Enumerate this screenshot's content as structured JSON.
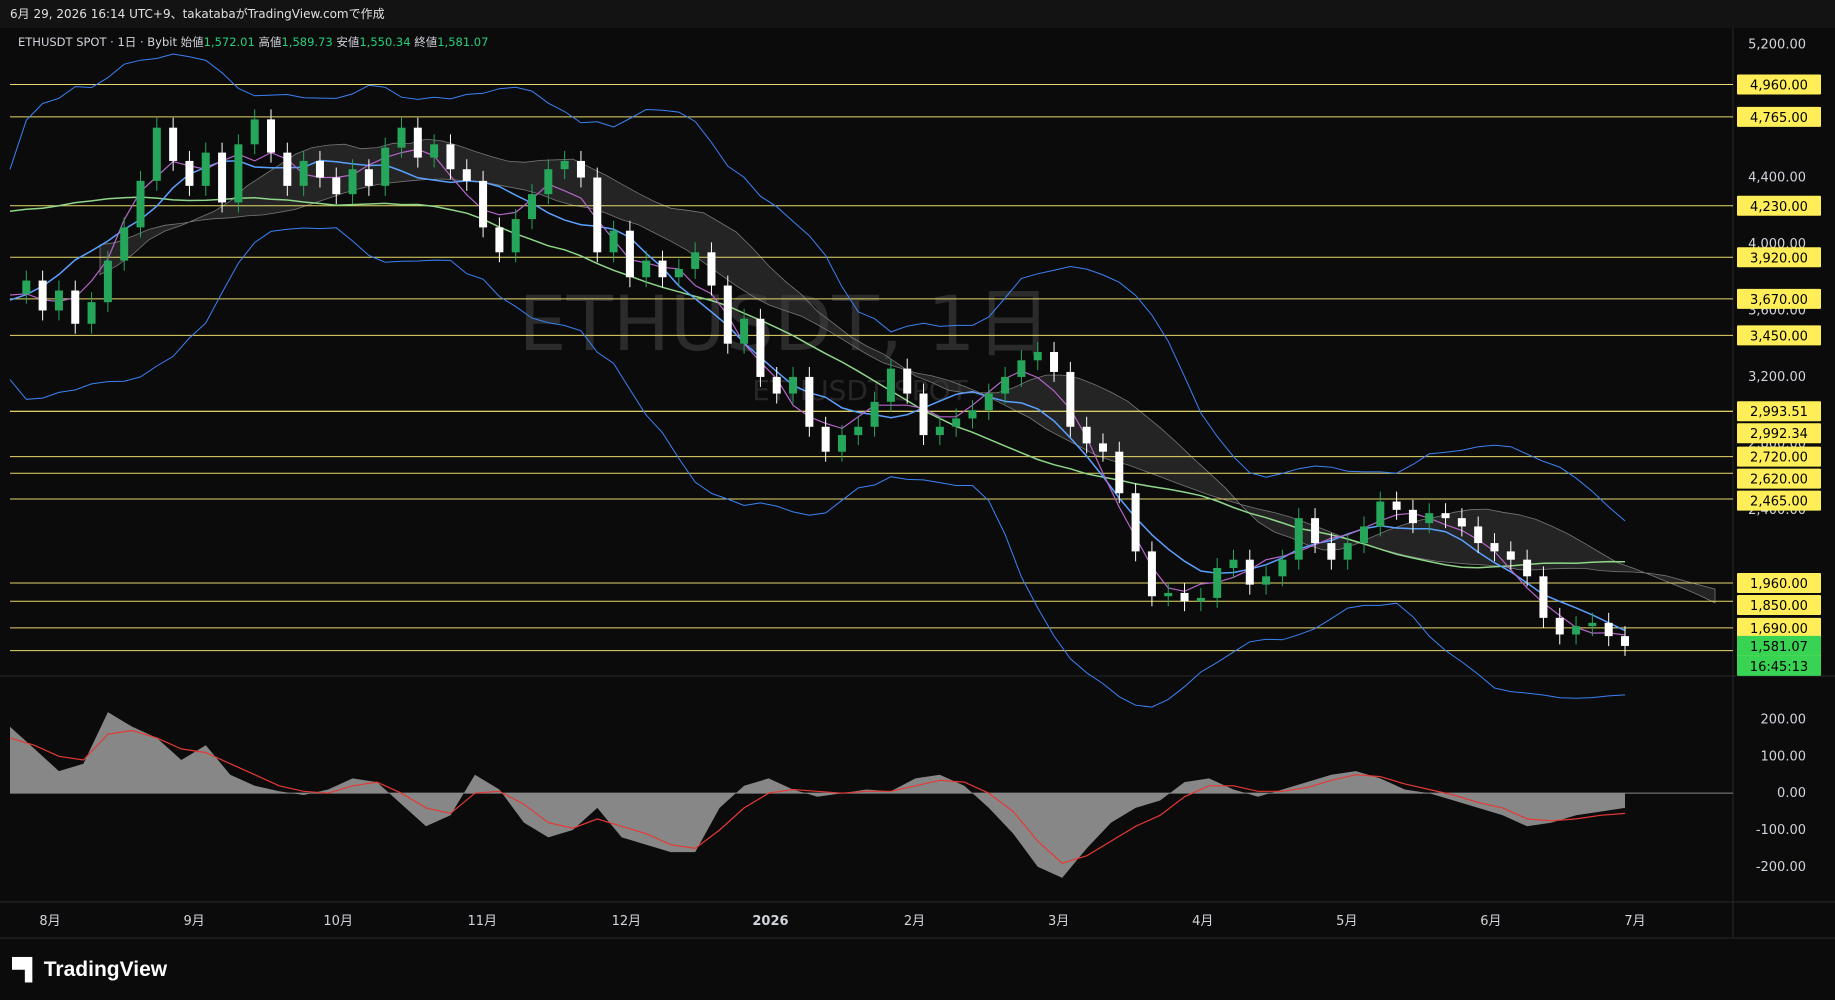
{
  "header": {
    "caption": "6月 29, 2026 16:14 UTC+9、takatabaがTradingView.comで作成"
  },
  "legend": {
    "symbol": "ETHUSDT SPOT · 1日 · Bybit",
    "open_label": "始値",
    "open": "1,572.01",
    "high_label": "高値",
    "high": "1,589.73",
    "low_label": "安値",
    "low": "1,550.34",
    "close_label": "終値",
    "close": "1,581.07"
  },
  "watermark": {
    "main": "ETHUSDT, 1日",
    "sub": "ETHUSDT SPOT"
  },
  "brand": {
    "name": "TradingView",
    "icon": "tradingview-logo-icon"
  },
  "colors": {
    "background": "#0b0b0b",
    "hline": "#e6d96a",
    "up": "#26a65b",
    "down": "#ffffff",
    "bb": "#3b82f6",
    "ma_short": "#b565c9",
    "ma_mid": "#5aa0ff",
    "ma_long": "#8fd68a",
    "cloud": "#3a3a3a",
    "macd_line": "#e53935",
    "macd_hist": "#9e9e9e",
    "badge_bg": "#ffee58",
    "badge_now": "#39d353"
  },
  "chart_data": [
    {
      "type": "candlestick",
      "title": "ETHUSDT, 1日",
      "price_axis_ticks": [
        "5,200.00",
        "4,400.00",
        "4,000.00",
        "3,600.00",
        "3,200.00",
        "2,800.00",
        "2,400.00"
      ],
      "ylim": [
        1400,
        5300
      ],
      "time_axis_labels": [
        "8月",
        "9月",
        "10月",
        "11月",
        "12月",
        "2026",
        "2月",
        "3月",
        "4月",
        "5月",
        "6月",
        "7月"
      ],
      "horizontal_levels": [
        "4,960.00",
        "4,765.00",
        "4,230.00",
        "3,920.00",
        "3,670.00",
        "3,450.00",
        "2,993.51",
        "2,992.34",
        "2,720.00",
        "2,620.00",
        "2,465.00",
        "1,960.00",
        "1,850.00",
        "1,690.00",
        "1,553.00"
      ],
      "current_price": "1,581.07",
      "countdown": "16:45:13",
      "price_series": [
        3700,
        3780,
        3600,
        3720,
        3520,
        3650,
        3900,
        4100,
        4380,
        4700,
        4500,
        4350,
        4550,
        4250,
        4600,
        4750,
        4550,
        4350,
        4500,
        4400,
        4300,
        4450,
        4350,
        4580,
        4700,
        4520,
        4600,
        4450,
        4380,
        4100,
        3950,
        4150,
        4300,
        4450,
        4500,
        4400,
        3950,
        4080,
        3800,
        3900,
        3800,
        3850,
        3950,
        3750,
        3400,
        3550,
        3200,
        3100,
        3200,
        2900,
        2750,
        2850,
        2900,
        3050,
        3250,
        3100,
        2850,
        2900,
        2950,
        3000,
        3100,
        3200,
        3300,
        3350,
        3230,
        2900,
        2800,
        2750,
        2500,
        2150,
        1880,
        1900,
        1850,
        1870,
        2050,
        2100,
        1950,
        2000,
        2100,
        2350,
        2200,
        2100,
        2200,
        2300,
        2450,
        2400,
        2320,
        2380,
        2350,
        2300,
        2200,
        2150,
        2100,
        2000,
        1750,
        1650,
        1700,
        1720,
        1640,
        1581
      ],
      "moving_averages": [
        "MA short (purple)",
        "MA mid (blue)",
        "MA long (green)"
      ],
      "bollinger_bands": true,
      "ichimoku_cloud": true
    },
    {
      "type": "histogram+line",
      "title": "",
      "y_ticks": [
        "200.00",
        "100.00",
        "0.00",
        "-100.00",
        "-200.00"
      ],
      "ylim": [
        -290,
        280
      ],
      "hist_values": [
        180,
        120,
        60,
        80,
        220,
        180,
        150,
        90,
        130,
        50,
        20,
        5,
        -5,
        10,
        40,
        30,
        -30,
        -90,
        -60,
        50,
        10,
        -80,
        -120,
        -100,
        -40,
        -120,
        -140,
        -160,
        -160,
        -40,
        20,
        40,
        10,
        -10,
        0,
        10,
        5,
        40,
        50,
        20,
        -40,
        -110,
        -200,
        -230,
        -150,
        -80,
        -40,
        -20,
        30,
        40,
        10,
        -10,
        10,
        30,
        50,
        60,
        40,
        10,
        0,
        -20,
        -40,
        -60,
        -90,
        -80,
        -60,
        -50,
        -40
      ],
      "signal_values": [
        150,
        130,
        100,
        90,
        160,
        170,
        150,
        120,
        110,
        80,
        50,
        20,
        5,
        0,
        20,
        30,
        0,
        -40,
        -55,
        0,
        5,
        -30,
        -80,
        -95,
        -70,
        -90,
        -110,
        -140,
        -150,
        -100,
        -40,
        0,
        10,
        5,
        0,
        5,
        5,
        20,
        35,
        30,
        0,
        -50,
        -130,
        -190,
        -170,
        -130,
        -90,
        -60,
        -10,
        20,
        20,
        5,
        5,
        15,
        35,
        50,
        45,
        25,
        10,
        -5,
        -25,
        -40,
        -70,
        -75,
        -70,
        -60,
        -55
      ]
    }
  ]
}
